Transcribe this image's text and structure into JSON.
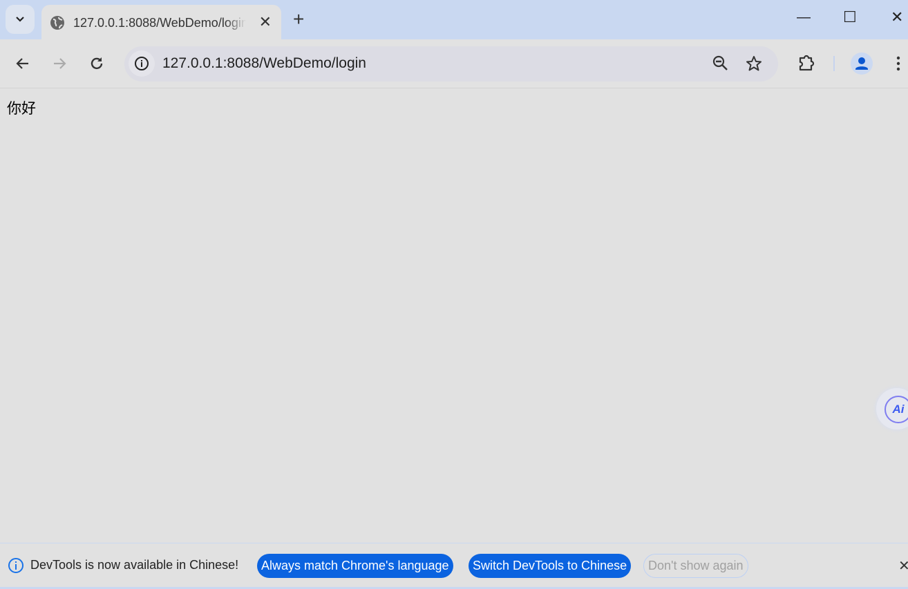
{
  "tab": {
    "title": "127.0.0.1:8088/WebDemo/login",
    "favicon": "globe-icon",
    "close": "✕"
  },
  "new_tab": "+",
  "window_controls": {
    "minimize": "—",
    "maximize": "☐",
    "close": "✕"
  },
  "toolbar": {
    "url": "127.0.0.1:8088/WebDemo/login"
  },
  "page": {
    "text": "你好"
  },
  "ai_button": {
    "label": "Ai"
  },
  "infobar": {
    "message": "DevTools is now available in Chinese!",
    "btn_match": "Always match Chrome's language",
    "btn_switch": "Switch DevTools to Chinese",
    "btn_dismiss": "Don't show again",
    "close": "✕"
  },
  "colors": {
    "accent": "#0b63e0",
    "tabstrip": "#c9d8f1",
    "page_bg": "#e1e1e1"
  }
}
